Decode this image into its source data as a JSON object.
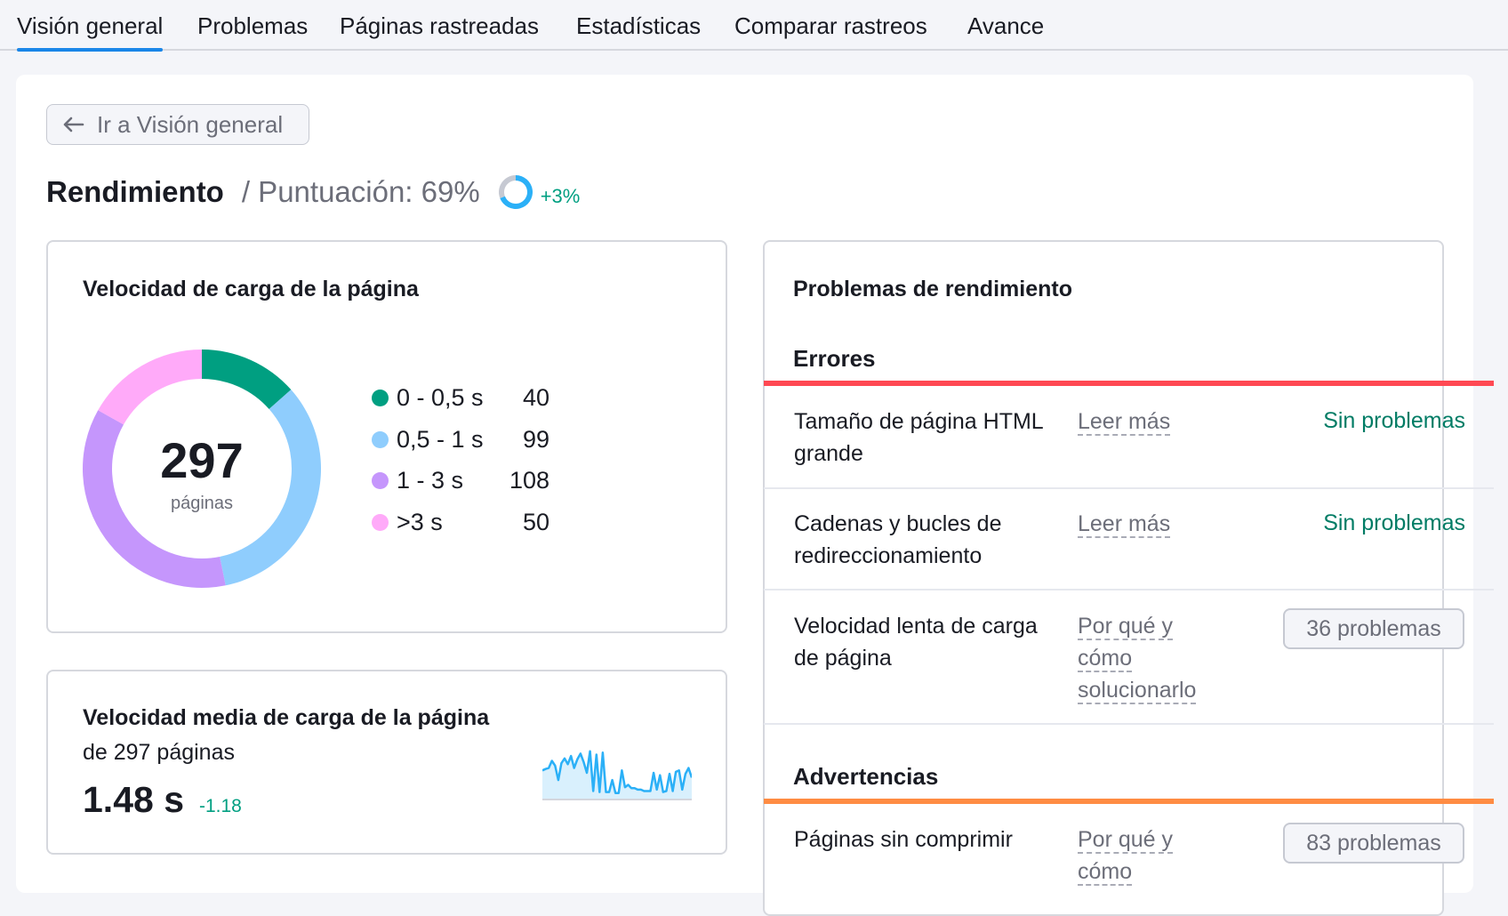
{
  "tabs": [
    {
      "label": "Visión general",
      "active": true
    },
    {
      "label": "Problemas",
      "active": false
    },
    {
      "label": "Páginas rastreadas",
      "active": false
    },
    {
      "label": "Estadísticas",
      "active": false
    },
    {
      "label": "Comparar rastreos",
      "active": false
    },
    {
      "label": "Avance",
      "active": false
    }
  ],
  "back_button": {
    "label": "Ir a Visión general",
    "icon": "arrow-left-icon"
  },
  "header": {
    "title": "Rendimiento",
    "score_label": "/ Puntuación: 69%",
    "score_percent": 69,
    "score_delta": "+3%",
    "colors": {
      "ring_fill": "#2bb0f7",
      "ring_track": "#c6c9d2"
    }
  },
  "page_speed": {
    "title": "Velocidad de carga de la página",
    "total": "297",
    "total_label": "páginas",
    "chart_data": {
      "type": "pie",
      "title": "Velocidad de carga de la página",
      "categories": [
        "0 - 0,5 s",
        "0,5 - 1 s",
        "1 - 3 s",
        ">3 s"
      ],
      "values": [
        40,
        99,
        108,
        50
      ],
      "colors": [
        "#009f81",
        "#8fcdfd",
        "#c596fc",
        "#ffaaf9"
      ],
      "center_text": "297 páginas",
      "legend": "right"
    }
  },
  "avg_speed": {
    "title": "Velocidad media de carga de la página",
    "subtitle": "de 297 páginas",
    "value": "1.48 s",
    "delta": "-1.18",
    "sparkline": {
      "type": "area",
      "color": "#2bb0f7",
      "fill": "#d9f0fd",
      "values": [
        0.55,
        0.58,
        0.6,
        0.75,
        0.65,
        0.35,
        0.7,
        0.8,
        0.68,
        0.85,
        0.6,
        0.78,
        0.9,
        0.72,
        0.5,
        0.95,
        0.12,
        0.88,
        0.1,
        0.92,
        0.1,
        0.1,
        0.35,
        0.08,
        0.08,
        0.55,
        0.2,
        0.25,
        0.18,
        0.18,
        0.15,
        0.15,
        0.12,
        0.12,
        0.12,
        0.5,
        0.15,
        0.45,
        0.1,
        0.12,
        0.48,
        0.12,
        0.52,
        0.55,
        0.15,
        0.48,
        0.6,
        0.4
      ]
    }
  },
  "issues": {
    "title": "Problemas de rendimiento",
    "sections": [
      {
        "title": "Errores",
        "color": "#ff4953",
        "rows": [
          {
            "name": "Tamaño de página HTML grande",
            "link": "Leer más",
            "status": "Sin problemas",
            "badge": null
          },
          {
            "name": "Cadenas y bucles de redireccionamiento",
            "link": "Leer más",
            "status": "Sin problemas",
            "badge": null
          },
          {
            "name": "Velocidad lenta de carga de página",
            "link": "Por qué y cómo solucionarlo",
            "status": null,
            "badge": "36 problemas"
          }
        ]
      },
      {
        "title": "Advertencias",
        "color": "#ff8c43",
        "rows": [
          {
            "name": "Páginas sin comprimir",
            "link": "Por qué y cómo",
            "status": null,
            "badge": "83 problemas"
          }
        ]
      }
    ]
  }
}
